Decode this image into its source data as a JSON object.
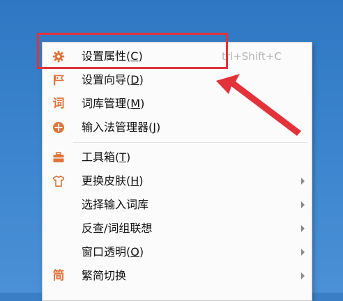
{
  "menu": {
    "items": [
      {
        "icon": "gear-icon",
        "label": "设置属性",
        "mnemonic": "C",
        "shortcut": "trl+Shift+C",
        "has_submenu": false
      },
      {
        "icon": "flag-icon",
        "label": "设置向导",
        "mnemonic": "D",
        "shortcut": "",
        "has_submenu": false
      },
      {
        "icon": "ci-character-icon",
        "label": "词库管理",
        "mnemonic": "M",
        "shortcut": "",
        "has_submenu": false
      },
      {
        "icon": "grid-circle-icon",
        "label": "输入法管理器",
        "mnemonic": "J",
        "shortcut": "",
        "has_submenu": false
      },
      {
        "icon": "toolbox-icon",
        "label": "工具箱",
        "mnemonic": "T",
        "shortcut": "",
        "has_submenu": false
      },
      {
        "icon": "shirt-icon",
        "label": "更换皮肤",
        "mnemonic": "H",
        "shortcut": "",
        "has_submenu": true
      },
      {
        "icon": "",
        "label": "选择输入词库",
        "mnemonic": "",
        "shortcut": "",
        "has_submenu": true
      },
      {
        "icon": "",
        "label": "反查/词组联想",
        "mnemonic": "",
        "shortcut": "",
        "has_submenu": true
      },
      {
        "icon": "",
        "label": "窗口透明",
        "mnemonic": "O",
        "shortcut": "",
        "has_submenu": true
      },
      {
        "icon": "jian-character-icon",
        "label": "繁简切换",
        "mnemonic": "",
        "shortcut": "",
        "has_submenu": true
      }
    ]
  },
  "icon_glyphs": {
    "ci": "词",
    "jian": "简"
  },
  "colors": {
    "icon_accent": "#e0733a",
    "highlight": "#e2323a",
    "desktop": "#3a7fc6"
  }
}
